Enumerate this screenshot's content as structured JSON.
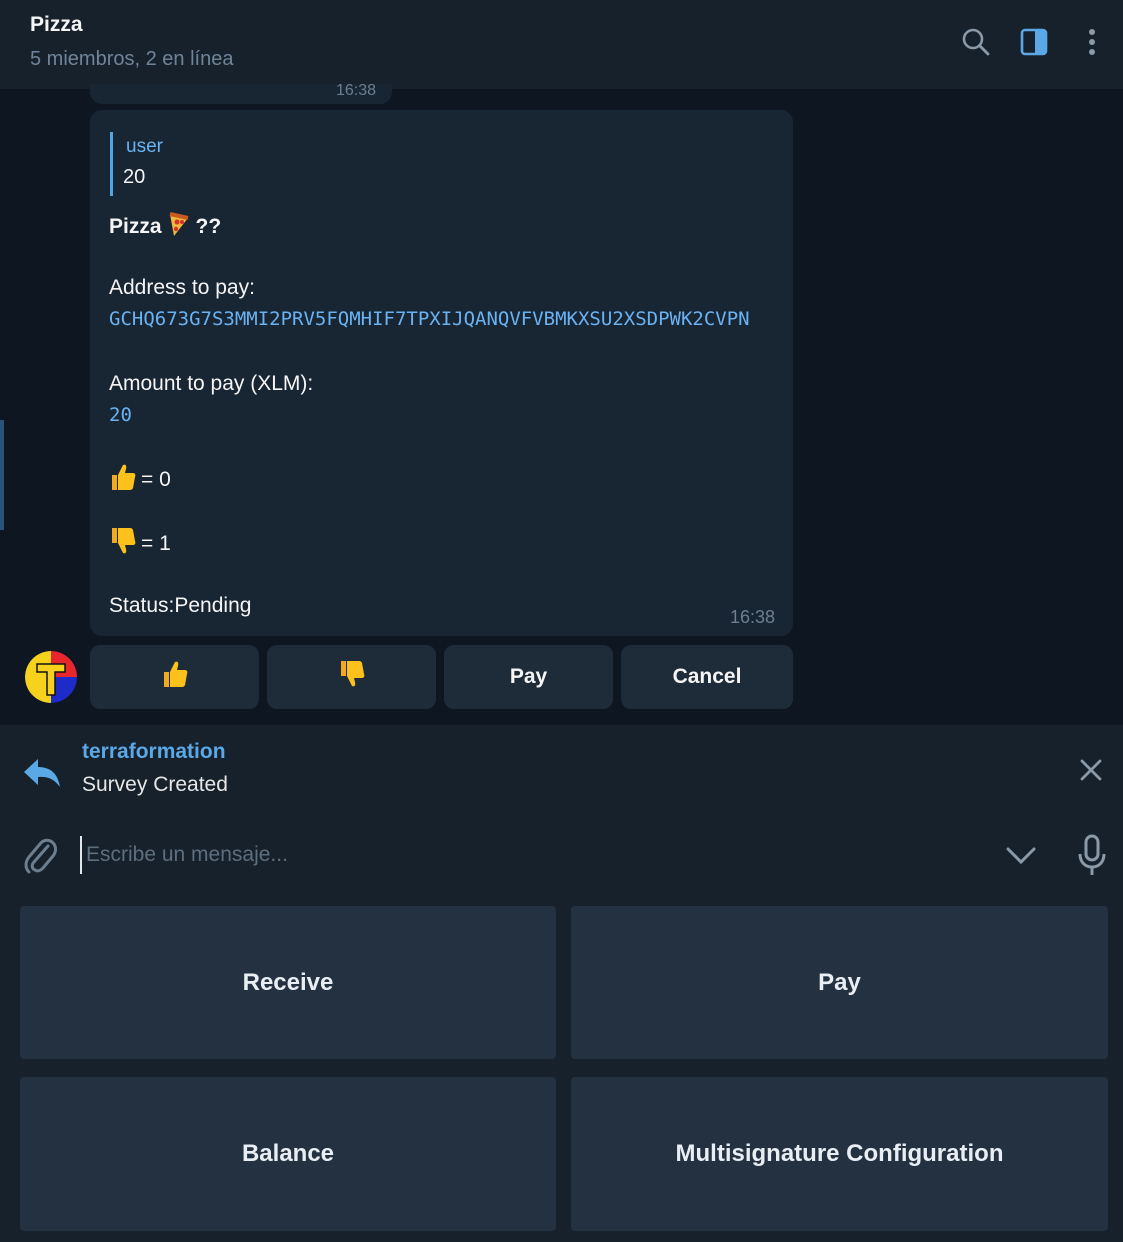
{
  "header": {
    "title": "Pizza",
    "subtitle": "5 miembros, 2 en línea"
  },
  "previous_message": {
    "time": "16:38"
  },
  "message": {
    "reply": {
      "name": "user",
      "text": "20"
    },
    "title": "Pizza",
    "title_suffix": "??",
    "address_label": "Address to pay:",
    "address": "GCHQ673G7S3MMI2PRV5FQMHIF7TPXIJQANQVFVBMKXSU2XSDPWK2CVPN",
    "amount_label": "Amount to pay (XLM):",
    "amount": "20",
    "upvotes": "= 0",
    "downvotes": "= 1",
    "status": "Status:Pending",
    "time": "16:38"
  },
  "inline_keyboard": {
    "pay": "Pay",
    "cancel": "Cancel"
  },
  "reply_bar": {
    "name": "terraformation",
    "text": "Survey Created"
  },
  "composer": {
    "placeholder": "Escribe un mensaje..."
  },
  "keyboard": {
    "receive": "Receive",
    "pay": "Pay",
    "balance": "Balance",
    "multisig": "Multisignature Configuration"
  },
  "colors": {
    "background": "#0e1621",
    "bubble": "#182533",
    "accent": "#6ab2f2",
    "panel": "#17212b"
  }
}
